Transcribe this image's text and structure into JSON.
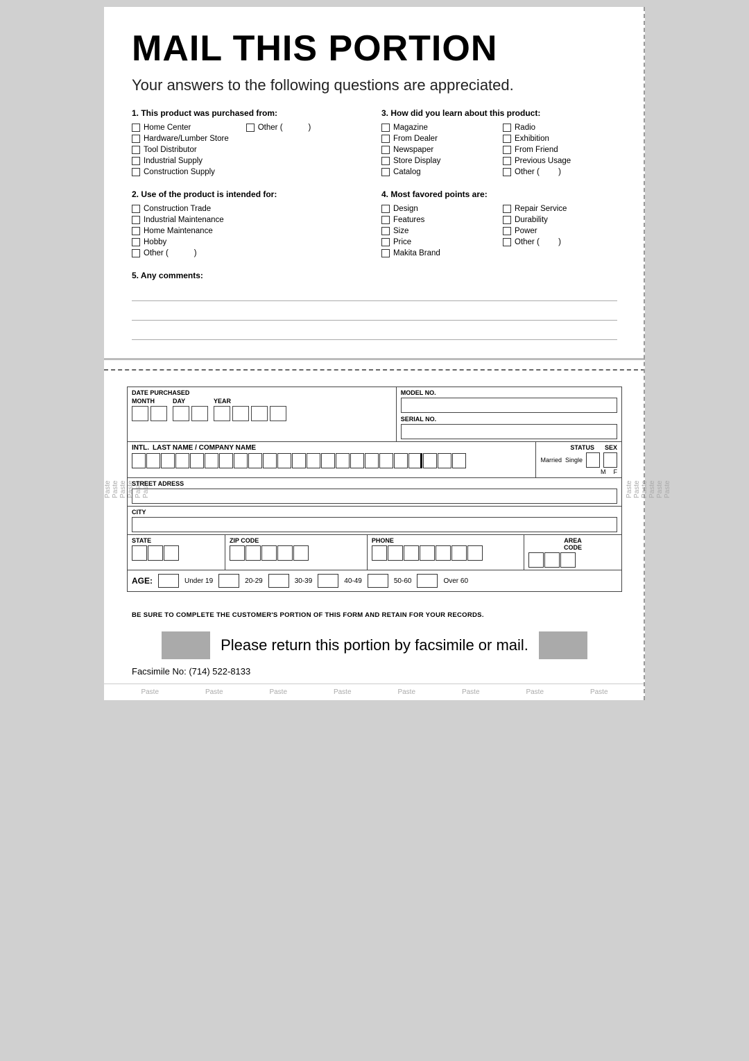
{
  "page": {
    "main_title": "MAIL THIS PORTION",
    "subtitle": "Your answers to the following questions are appreciated.",
    "q1_title": "1. This product was purchased from:",
    "q1_options_col1": [
      "Home Center",
      "Hardware/Lumber Store",
      "Tool Distributor",
      "Industrial Supply",
      "Construction Supply"
    ],
    "q1_other_label": "Other (",
    "q1_other_close": ")",
    "q2_title": "2. Use of the product is intended for:",
    "q2_options": [
      "Construction Trade",
      "Industrial Maintenance",
      "Home Maintenance",
      "Hobby",
      "Other ("
    ],
    "q2_other_close": ")",
    "q3_title": "3. How did you learn about this product:",
    "q3_col1": [
      "Magazine",
      "From Dealer",
      "Newspaper",
      "Store Display",
      "Catalog"
    ],
    "q3_col2": [
      "Radio",
      "Exhibition",
      "From Friend",
      "Previous Usage",
      "Other ("
    ],
    "q3_other_close": ")",
    "q4_title": "4. Most favored points are:",
    "q4_col1": [
      "Design",
      "Features",
      "Size",
      "Price",
      "Makita Brand"
    ],
    "q4_col2": [
      "Repair Service",
      "Durability",
      "Power",
      "Other ("
    ],
    "q4_other_close": ")",
    "q5_title": "5. Any comments:",
    "form": {
      "date_purchased": "DATE PURCHASED",
      "month": "MONTH",
      "day": "DAY",
      "year": "YEAR",
      "model_no": "MODEL NO.",
      "serial_no": "SERIAL NO.",
      "intl": "INTL.",
      "last_name": "LAST NAME / COMPANY NAME",
      "status": "STATUS",
      "sex": "SEX",
      "married": "Married",
      "single": "Single",
      "m": "M",
      "f": "F",
      "street": "STREET ADRESS",
      "city": "CITY",
      "state": "STATE",
      "zip": "ZIP CODE",
      "phone": "PHONE",
      "area_code": "AREA CODE",
      "age": "AGE:",
      "age_ranges": [
        "Under 19",
        "20-29",
        "30-39",
        "40-49",
        "50-60",
        "Over 60"
      ]
    },
    "bottom_note": "BE SURE TO COMPLETE THE CUSTOMER'S PORTION OF THIS FORM AND RETAIN FOR YOUR RECORDS.",
    "return_text": "Please return this portion by facsimile or mail.",
    "fax": "Facsimile No: (714) 522-8133",
    "paste_labels": [
      "Paste",
      "Paste",
      "Paste",
      "Paste",
      "Paste",
      "Paste",
      "Paste",
      "Paste"
    ],
    "paste_side_labels": [
      "Paste",
      "Paste",
      "Paste",
      "Paste",
      "Paste",
      "Paste"
    ]
  }
}
